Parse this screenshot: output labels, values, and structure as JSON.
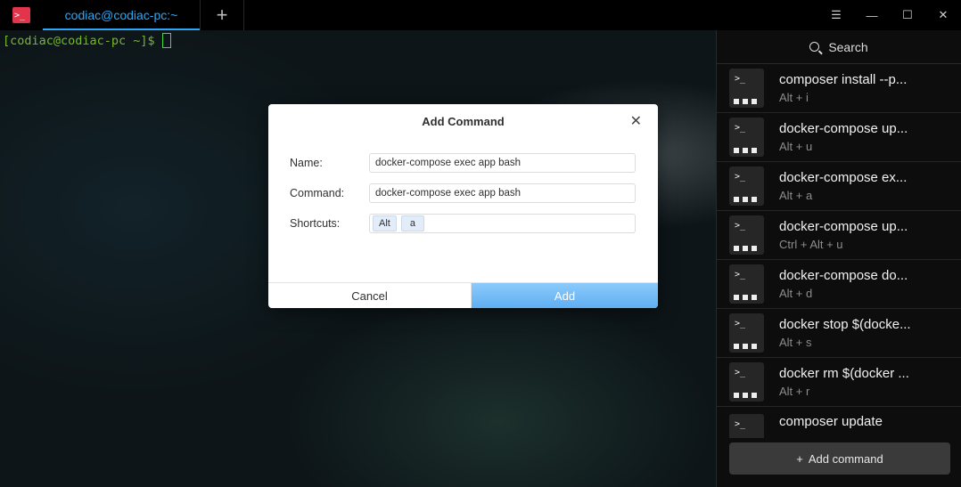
{
  "titlebar": {
    "logo_glyph": ">_",
    "tab_title": "codiac@codiac-pc:~",
    "new_tab_glyph": "+",
    "menu_glyph": "☰",
    "minimize_glyph": "—",
    "maximize_glyph": "☐",
    "close_glyph": "✕"
  },
  "terminal": {
    "prompt": "[codiac@codiac-pc ~]$"
  },
  "panel": {
    "search_label": "Search",
    "icon_glyph": ">_",
    "commands": [
      {
        "name": "composer install --p...",
        "shortcut": "Alt + i"
      },
      {
        "name": "docker-compose up...",
        "shortcut": "Alt + u"
      },
      {
        "name": "docker-compose ex...",
        "shortcut": "Alt + a"
      },
      {
        "name": "docker-compose up...",
        "shortcut": "Ctrl + Alt + u"
      },
      {
        "name": "docker-compose do...",
        "shortcut": "Alt + d"
      },
      {
        "name": "docker stop $(docke...",
        "shortcut": "Alt + s"
      },
      {
        "name": "docker rm $(docker ...",
        "shortcut": "Alt + r"
      },
      {
        "name": "composer update",
        "shortcut": ""
      }
    ],
    "add_button_plus": "+",
    "add_button_label": "Add command"
  },
  "dialog": {
    "title": "Add Command",
    "close_glyph": "✕",
    "name_label": "Name:",
    "name_value": "docker-compose exec app bash",
    "command_label": "Command:",
    "command_value": "docker-compose exec app bash",
    "shortcuts_label": "Shortcuts:",
    "shortcut_keys": [
      "Alt",
      "a"
    ],
    "cancel_label": "Cancel",
    "add_label": "Add"
  },
  "colors": {
    "accent": "#2ca7f8",
    "logo": "#e2344a",
    "prompt": "#74b92a",
    "cursor": "#3fdc3f",
    "add_button": "#5faff2"
  }
}
